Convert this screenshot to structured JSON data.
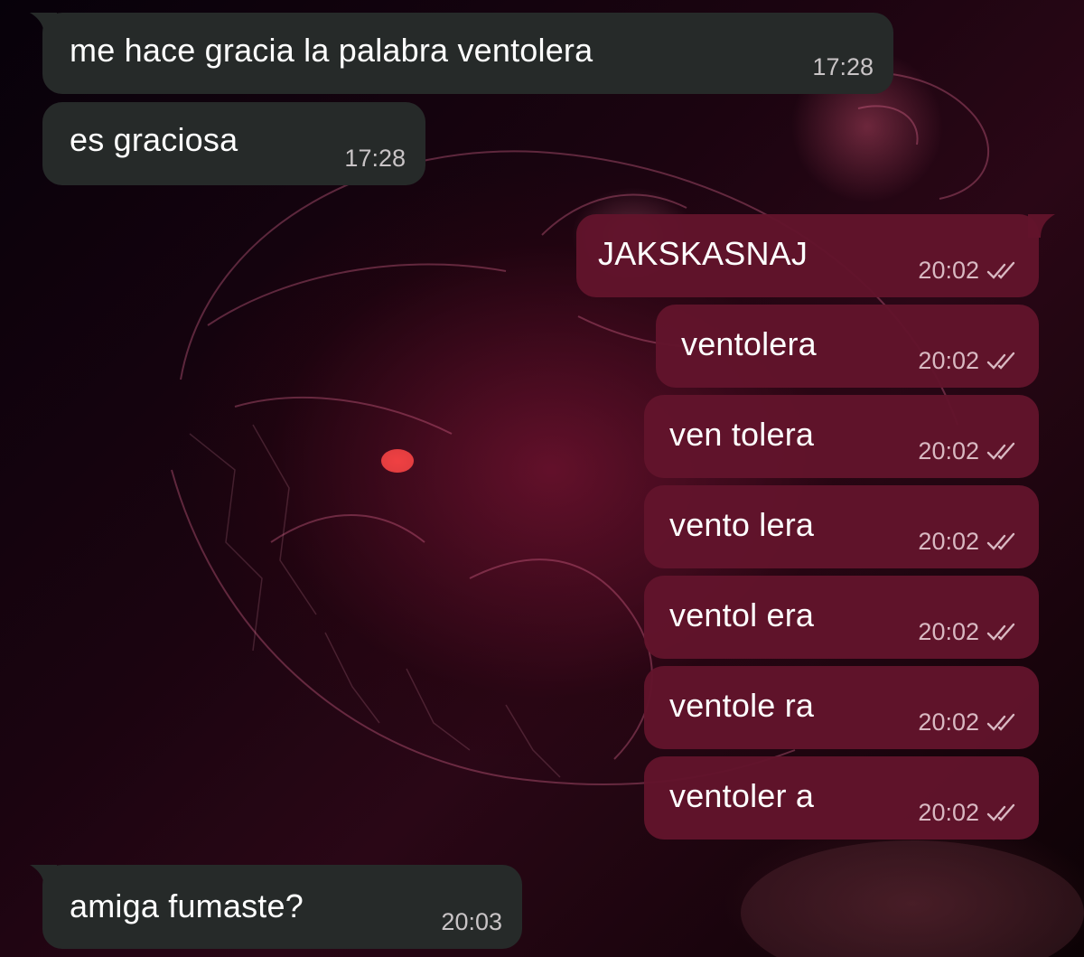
{
  "colors": {
    "incoming_bubble": "#262a29",
    "outgoing_bubble": "#62142c",
    "read_check": "#d9b9c2"
  },
  "messages": [
    {
      "direction": "incoming",
      "text": "me hace gracia la palabra ventolera",
      "time": "17:28"
    },
    {
      "direction": "incoming",
      "text": "es graciosa",
      "time": "17:28"
    },
    {
      "direction": "outgoing",
      "text": "JAKSKASNAJ",
      "time": "20:02",
      "status_icon": "double-check-icon"
    },
    {
      "direction": "outgoing",
      "text": "ventolera",
      "time": "20:02",
      "status_icon": "double-check-icon"
    },
    {
      "direction": "outgoing",
      "text": "ven tolera",
      "time": "20:02",
      "status_icon": "double-check-icon"
    },
    {
      "direction": "outgoing",
      "text": "vento lera",
      "time": "20:02",
      "status_icon": "double-check-icon"
    },
    {
      "direction": "outgoing",
      "text": "ventol era",
      "time": "20:02",
      "status_icon": "double-check-icon"
    },
    {
      "direction": "outgoing",
      "text": "ventole ra",
      "time": "20:02",
      "status_icon": "double-check-icon"
    },
    {
      "direction": "outgoing",
      "text": "ventoler a",
      "time": "20:02",
      "status_icon": "double-check-icon"
    },
    {
      "direction": "incoming",
      "text": "amiga fumaste?",
      "time": "20:03"
    }
  ]
}
